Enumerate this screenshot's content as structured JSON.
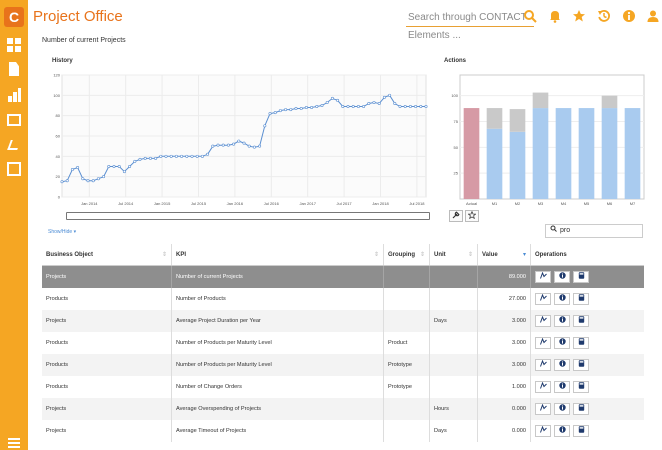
{
  "app": {
    "logo": "C",
    "title": "Project Office",
    "search_placeholder": "Search through CONTACT Elements ..."
  },
  "topicons": [
    "search-icon",
    "bell-icon",
    "star-icon",
    "history-icon",
    "info-icon",
    "user-icon"
  ],
  "page": {
    "title": "Number of current Projects",
    "history_label": "History",
    "actions_label": "Actions",
    "show_hide": "Show/Hide ▾",
    "filter_value": "pro"
  },
  "colors": {
    "accent": "#f5a623",
    "brand": "#e8731b",
    "line": "#5b8fd1",
    "bar_blue": "#a9cbef",
    "bar_red": "#d69aa5",
    "bar_grey": "#c9c9c9"
  },
  "chart_data": [
    {
      "type": "line",
      "title": "History",
      "ylim": [
        0,
        120
      ],
      "yticks": [
        0,
        20,
        40,
        60,
        80,
        100,
        120
      ],
      "xticks": [
        "Jan 2014",
        "Jul 2014",
        "Jan 2015",
        "Jul 2015",
        "Jan 2016",
        "Jul 2016",
        "Jan 2017",
        "Jul 2017",
        "Jan 2018",
        "Jul 2018"
      ],
      "x": [
        0,
        0.7,
        1,
        1.5,
        2,
        2.5,
        3,
        3.5,
        4,
        4.5,
        5,
        5.5,
        6,
        6.5,
        7,
        7.5,
        8,
        8.5,
        9,
        9.5,
        10,
        10.5,
        11,
        11.5,
        12,
        12.5,
        13,
        13.5,
        14,
        14.5,
        15,
        15.5,
        16,
        16.5,
        17,
        17.5,
        18,
        18.5,
        19,
        19.5,
        20,
        20.5,
        21,
        21.5,
        22,
        22.5,
        23,
        23.5,
        24,
        24.5,
        25,
        25.5,
        26,
        26.5,
        27,
        27.5,
        28,
        28.5,
        29,
        29.5,
        30,
        30.5,
        31,
        31.5,
        32,
        32.5,
        33,
        33.5,
        34,
        34.5,
        35,
        35.5,
        36,
        36.5,
        37,
        37.5,
        38,
        38.5,
        39,
        39.5,
        40,
        40.5,
        41,
        41.5,
        42,
        42.5,
        43,
        43.5,
        44,
        44.5,
        45,
        45.5,
        46,
        46.5,
        47,
        47.5,
        48,
        48.5,
        49,
        49.5,
        50,
        50.5,
        51,
        51.5,
        52,
        52.5,
        53,
        53.5,
        54,
        54.5,
        55
      ],
      "y": [
        15,
        16,
        27,
        29,
        18,
        16,
        16,
        18,
        20,
        30,
        30,
        30,
        25,
        30,
        35,
        37,
        38,
        38,
        38,
        40,
        40,
        40,
        40,
        40,
        40,
        40,
        40,
        40,
        42,
        50,
        51,
        51,
        51,
        52,
        55,
        53,
        50,
        49,
        50,
        70,
        82,
        83,
        85,
        86,
        86,
        87,
        87,
        88,
        88,
        89,
        90,
        93,
        97,
        95,
        89,
        89,
        89,
        89,
        89,
        92,
        93,
        92,
        98,
        100,
        92,
        89,
        89,
        89,
        89,
        89,
        89
      ],
      "series": [
        {
          "values": [
            15,
            16,
            27,
            29,
            18,
            16,
            16,
            18,
            20,
            30,
            30,
            30,
            25,
            30,
            35,
            37,
            38,
            38,
            38,
            40,
            40,
            40,
            40,
            40,
            40,
            40,
            40,
            40,
            42,
            50,
            51,
            51,
            51,
            52,
            55,
            53,
            50,
            49,
            50,
            70,
            82,
            83,
            85,
            86,
            86,
            87,
            87,
            88,
            88,
            89,
            90,
            93,
            97,
            95,
            89,
            89,
            89,
            89,
            89,
            92,
            93,
            92,
            98,
            100,
            92,
            89,
            89,
            89,
            89,
            89,
            89
          ]
        }
      ]
    },
    {
      "type": "bar",
      "title": "Actions",
      "categories": [
        "Actual",
        "M1",
        "M2",
        "M3",
        "M4",
        "M5",
        "M6",
        "M7"
      ],
      "ylim": [
        0,
        120
      ],
      "yticks": [
        25,
        50,
        75,
        100
      ],
      "series": [
        {
          "values": [
            88,
            68,
            65,
            88,
            88,
            88,
            88,
            88
          ]
        },
        {
          "values": [
            0,
            20,
            22,
            15,
            0,
            0,
            12,
            0
          ]
        }
      ]
    }
  ],
  "table": {
    "headers": [
      "Business Object",
      "KPI",
      "Grouping",
      "Unit",
      "Value",
      "Operations"
    ],
    "rows": [
      {
        "obj": "Projects",
        "kpi": "Number of current Projects",
        "group": "",
        "unit": "",
        "value": "89.000"
      },
      {
        "obj": "Products",
        "kpi": "Number of Products",
        "group": "",
        "unit": "",
        "value": "27.000"
      },
      {
        "obj": "Projects",
        "kpi": "Average Project Duration per Year",
        "group": "",
        "unit": "Days",
        "value": "3.000"
      },
      {
        "obj": "Products",
        "kpi": "Number of Products per Maturity Level",
        "group": "Product",
        "unit": "",
        "value": "3.000"
      },
      {
        "obj": "Products",
        "kpi": "Number of Products per Maturity Level",
        "group": "Prototype",
        "unit": "",
        "value": "3.000"
      },
      {
        "obj": "Products",
        "kpi": "Number of Change Orders",
        "group": "Prototype",
        "unit": "",
        "value": "1.000"
      },
      {
        "obj": "Projects",
        "kpi": "Average Overspending of Projects",
        "group": "",
        "unit": "Hours",
        "value": "0.000"
      },
      {
        "obj": "Projects",
        "kpi": "Average Timeout of Projects",
        "group": "",
        "unit": "Days",
        "value": "0.000"
      }
    ]
  }
}
